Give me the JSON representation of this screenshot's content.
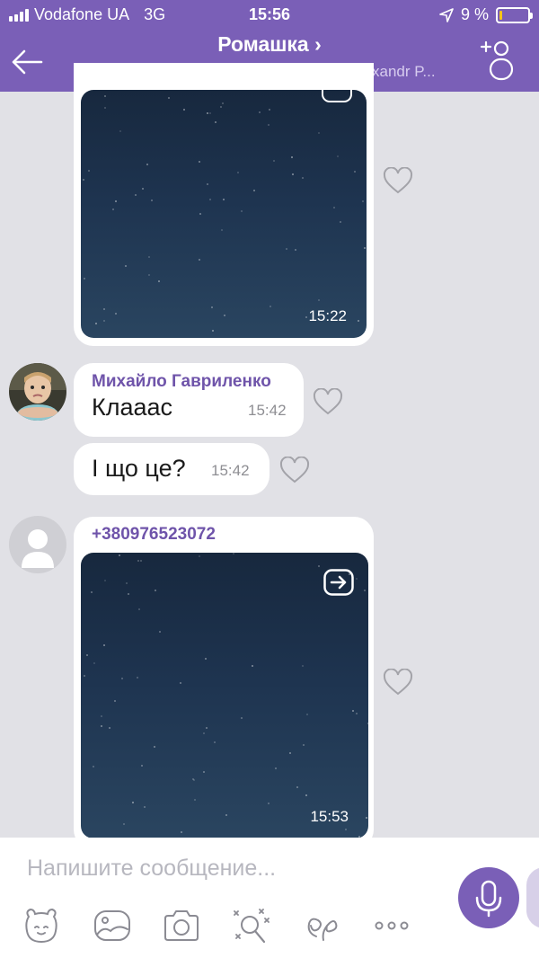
{
  "status_bar": {
    "carrier": "Vodafone UA",
    "network": "3G",
    "time": "15:56",
    "battery_percent": "9 %",
    "battery_level": 0.09
  },
  "header": {
    "title": "Ромашка ›",
    "subtitle": "Eeugenka, Iren, Iren Zlochevskaya, Olexandr P...",
    "color": "#7a5fb7"
  },
  "messages": [
    {
      "type": "photo",
      "time": "15:22"
    },
    {
      "type": "text",
      "sender": "Михайло Гавриленко",
      "text": "Клааас",
      "time": "15:42"
    },
    {
      "type": "text",
      "text": "І що це?",
      "time": "15:42"
    },
    {
      "type": "photo",
      "sender": "+380976523072",
      "time": "15:53"
    }
  ],
  "composer": {
    "placeholder": "Напишите сообщение..."
  },
  "icons": [
    "back-arrow-icon",
    "add-member-icon",
    "heart-icon",
    "share-forward-icon",
    "sticker-icon",
    "gallery-icon",
    "camera-icon",
    "doodle-icon",
    "gif-icon",
    "more-icon",
    "mic-icon"
  ],
  "colors": {
    "accent": "#7a5fb7",
    "sender_name": "#6f54aa",
    "chat_background": "#e1e1e6"
  }
}
